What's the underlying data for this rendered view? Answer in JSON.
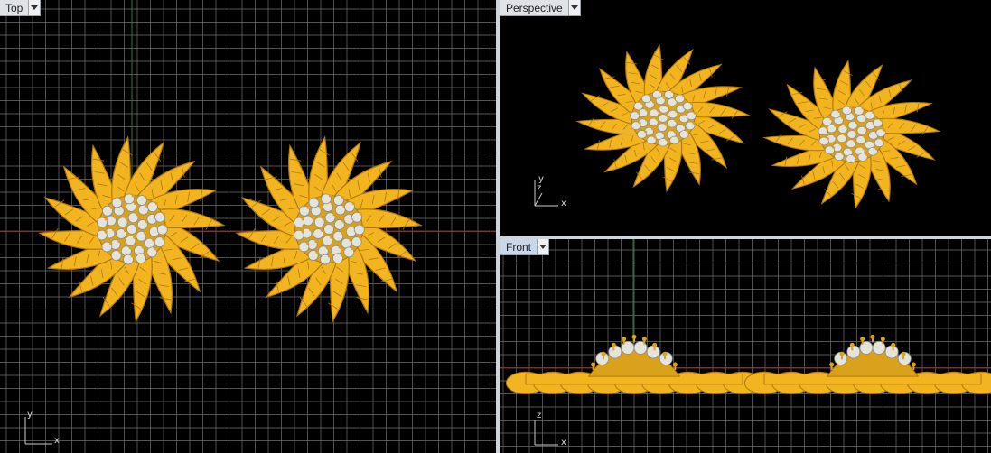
{
  "viewports": {
    "top": {
      "label": "Top",
      "axis_x": "x",
      "axis_y": "y"
    },
    "perspective": {
      "label": "Perspective",
      "axis_x": "x",
      "axis_y": "y",
      "axis_z": "z"
    },
    "front": {
      "label": "Front",
      "axis_x": "x",
      "axis_z": "z"
    }
  },
  "colors": {
    "background": "#000000",
    "grid": "#6f6f6f",
    "grid_major": "#a8a8a8",
    "axis_x": "#8a1f1f",
    "axis_y": "#2f7a2f",
    "petal": "#f2b51f",
    "petal_shadow": "#b07810",
    "gem": "#e4e4dc",
    "prong": "#d9a21a"
  },
  "icons": {
    "tab_menu": "chevron-down-icon",
    "axes": "axis-widget-icon"
  }
}
